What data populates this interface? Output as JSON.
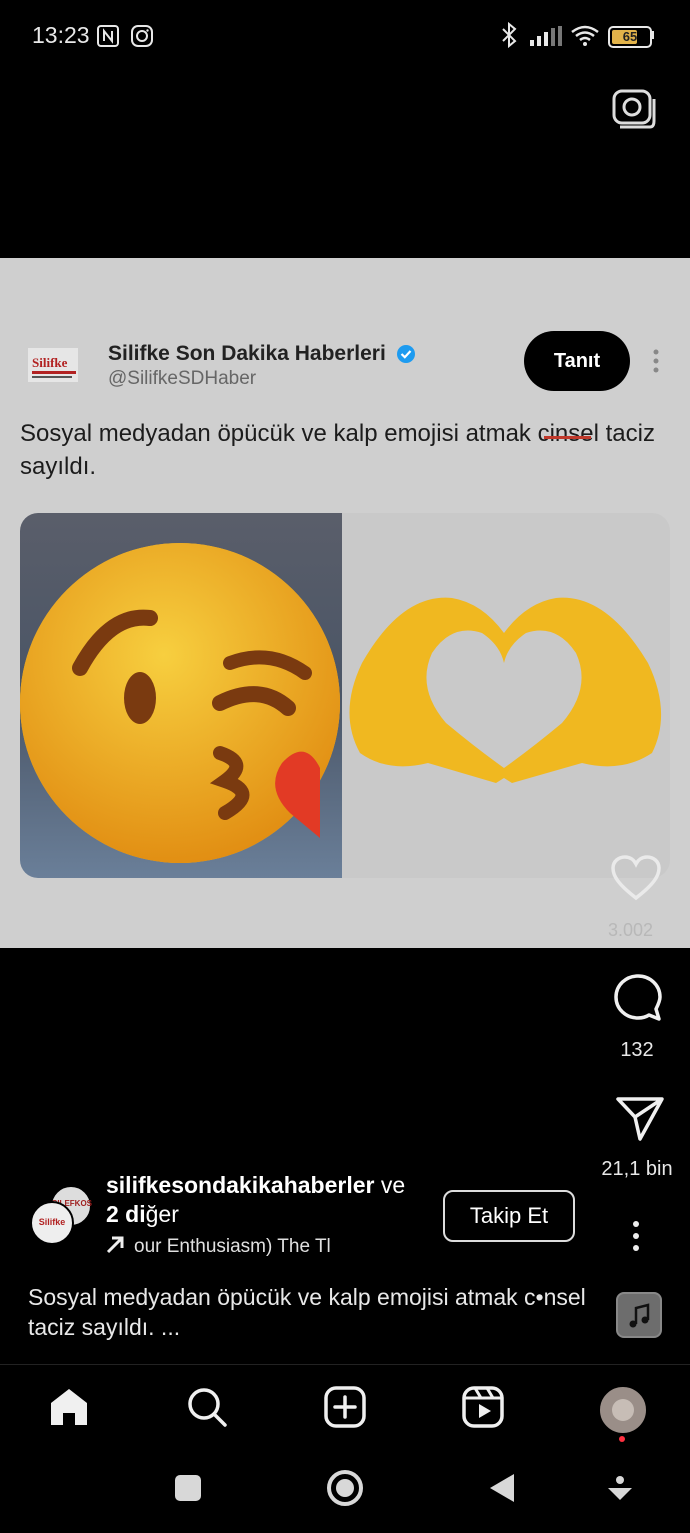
{
  "status_bar": {
    "time": "13:23",
    "battery": "65",
    "icons": [
      "nfc-icon",
      "instagram-icon",
      "bluetooth-icon",
      "signal-icon",
      "wifi-icon",
      "battery-icon"
    ]
  },
  "tweet": {
    "name": "Silifke Son Dakika Haberleri",
    "handle": "@SilifkeSDHaber",
    "button_label": "Tanıt",
    "text_part1": "Sosyal medyadan öpücük ve kalp emojisi atmak ",
    "text_struck": "cinsel",
    "text_part2": " taciz sayıldı.",
    "logo_text": "Silifke",
    "card_like_count": "3.002",
    "images": [
      "kiss-emoji",
      "heart-hands-emoji"
    ]
  },
  "actions": {
    "comments": "132",
    "shares": "21,1 bin"
  },
  "reel": {
    "author": "silifkesondakikahaberler",
    "author_suffix": " ve",
    "others_bold": "2 di",
    "others_rest": "ğer",
    "audio": "our Enthusiasm)    The Tl",
    "follow_label": "Takip Et",
    "caption": "Sosyal medyadan öpücük ve kalp emojisi atmak c•nsel taciz sayıldı. ..."
  },
  "nav": [
    "home-icon",
    "search-icon",
    "create-icon",
    "reels-icon",
    "profile-avatar"
  ],
  "system_nav": [
    "recents-icon",
    "home-circle-icon",
    "back-icon",
    "keyboard-hide-icon"
  ],
  "colors": {
    "accent_verified": "#1d9bf0",
    "notification_dot": "#ff3040",
    "card_bg": "#cfcfcf"
  }
}
